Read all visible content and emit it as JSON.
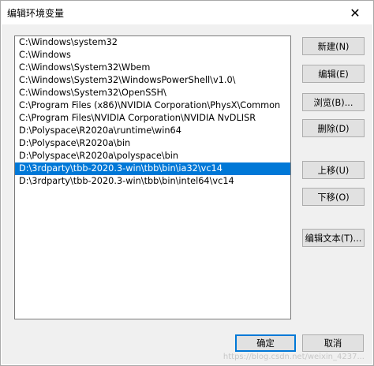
{
  "window": {
    "title": "编辑环境变量",
    "close_glyph": "✕"
  },
  "list": {
    "items": [
      "C:\\Windows\\system32",
      "C:\\Windows",
      "C:\\Windows\\System32\\Wbem",
      "C:\\Windows\\System32\\WindowsPowerShell\\v1.0\\",
      "C:\\Windows\\System32\\OpenSSH\\",
      "C:\\Program Files (x86)\\NVIDIA Corporation\\PhysX\\Common",
      "C:\\Program Files\\NVIDIA Corporation\\NVIDIA NvDLISR",
      "D:\\Polyspace\\R2020a\\runtime\\win64",
      "D:\\Polyspace\\R2020a\\bin",
      "D:\\Polyspace\\R2020a\\polyspace\\bin",
      "D:\\3rdparty\\tbb-2020.3-win\\tbb\\bin\\ia32\\vc14",
      "D:\\3rdparty\\tbb-2020.3-win\\tbb\\bin\\intel64\\vc14"
    ],
    "selected_index": 10
  },
  "buttons": {
    "new": "新建(N)",
    "edit": "编辑(E)",
    "browse": "浏览(B)...",
    "delete": "删除(D)",
    "move_up": "上移(U)",
    "move_down": "下移(O)",
    "edit_text": "编辑文本(T)...",
    "ok": "确定",
    "cancel": "取消"
  },
  "watermark": "https://blog.csdn.net/weixin_4237..."
}
